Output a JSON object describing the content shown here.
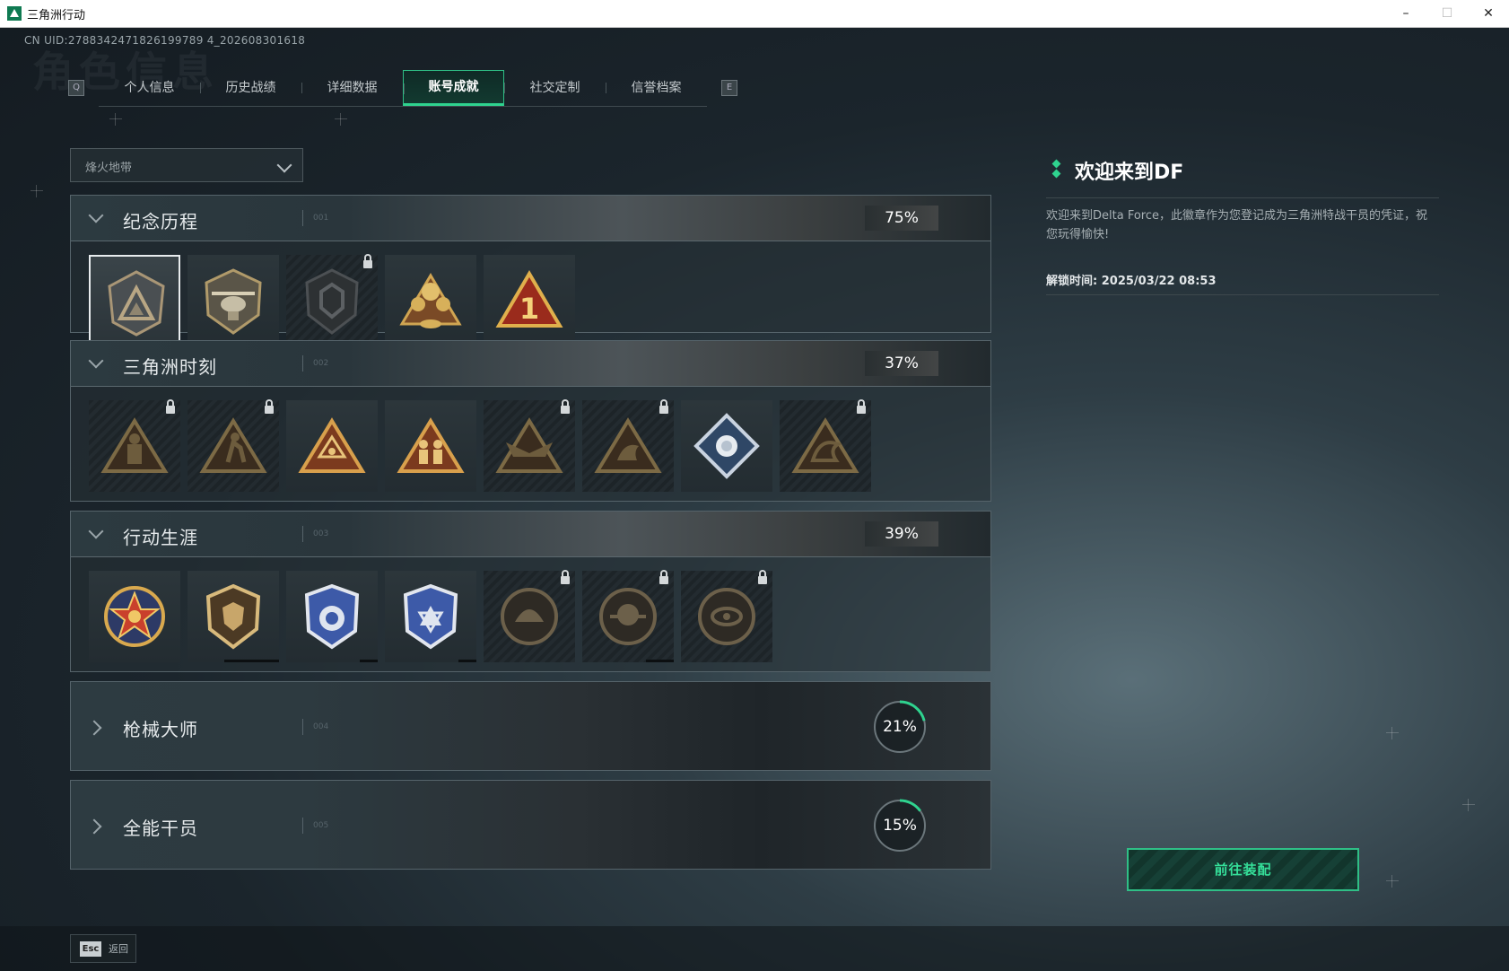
{
  "window": {
    "title": "三角洲行动",
    "controls": [
      "–",
      "☐",
      "✕"
    ]
  },
  "uid": "CN UID:2788342471826199789 4_202608301618",
  "header": {
    "bg_title": "角色信息",
    "left_key": "Q",
    "right_key": "E"
  },
  "tabs": [
    {
      "label": "个人信息",
      "active": false
    },
    {
      "label": "历史战绩",
      "active": false
    },
    {
      "label": "详细数据",
      "active": false
    },
    {
      "label": "账号成就",
      "active": true
    },
    {
      "label": "社交定制",
      "active": false
    },
    {
      "label": "信誉档案",
      "active": false
    }
  ],
  "mode_select": {
    "value": "烽火地带"
  },
  "sections": [
    {
      "title": "纪念历程",
      "code": "001",
      "percent": "75%",
      "expanded": true,
      "badges": [
        {
          "icon": "delta-emblem-icon",
          "locked": false,
          "selected": true
        },
        {
          "icon": "helicopter-emblem-icon",
          "locked": false
        },
        {
          "icon": "dark-shield-emblem-icon",
          "locked": true
        },
        {
          "icon": "gold-crest-emblem-icon",
          "locked": false
        },
        {
          "icon": "number-one-triangle-icon",
          "locked": false
        }
      ]
    },
    {
      "title": "三角洲时刻",
      "code": "002",
      "percent": "37%",
      "expanded": true,
      "badges": [
        {
          "icon": "triangle-figure-icon",
          "locked": true
        },
        {
          "icon": "triangle-runner-icon",
          "locked": true
        },
        {
          "icon": "triangle-eye-icon",
          "locked": false
        },
        {
          "icon": "triangle-soldiers-icon",
          "locked": false
        },
        {
          "icon": "triangle-wings-icon",
          "locked": true
        },
        {
          "icon": "triangle-dolphin-icon",
          "locked": true
        },
        {
          "icon": "diamond-rose-icon",
          "locked": false
        },
        {
          "icon": "triangle-dragon-icon",
          "locked": true
        }
      ]
    },
    {
      "title": "行动生涯",
      "code": "003",
      "percent": "39%",
      "expanded": true,
      "badges": [
        {
          "icon": "star-medal-icon",
          "locked": false
        },
        {
          "icon": "gold-shield-medal-icon",
          "locked": false
        },
        {
          "icon": "blue-shield-medal-icon",
          "locked": false
        },
        {
          "icon": "blue-star-shield-medal-icon",
          "locked": false
        },
        {
          "icon": "round-helmet-medal-icon",
          "locked": true
        },
        {
          "icon": "round-skull-medal-icon",
          "locked": true
        },
        {
          "icon": "round-eye-medal-icon",
          "locked": true
        }
      ]
    },
    {
      "title": "枪械大师",
      "code": "004",
      "percent": "21%",
      "percent_value": 0.21,
      "expanded": false
    },
    {
      "title": "全能干员",
      "code": "005",
      "percent": "15%",
      "percent_value": 0.15,
      "expanded": false
    }
  ],
  "detail": {
    "title": "欢迎来到DF",
    "description": "欢迎来到Delta Force，此徽章作为您登记成为三角洲特战干员的凭证，祝您玩得愉快!",
    "unlock_time": "解锁时间: 2025/03/22 08:53"
  },
  "equip_button": "前往装配",
  "footer": {
    "key": "Esc",
    "label": "返回"
  },
  "colors": {
    "accent": "#2fd38f",
    "badge_gold": "#c9a35a",
    "badge_blue": "#3d5aa8"
  }
}
